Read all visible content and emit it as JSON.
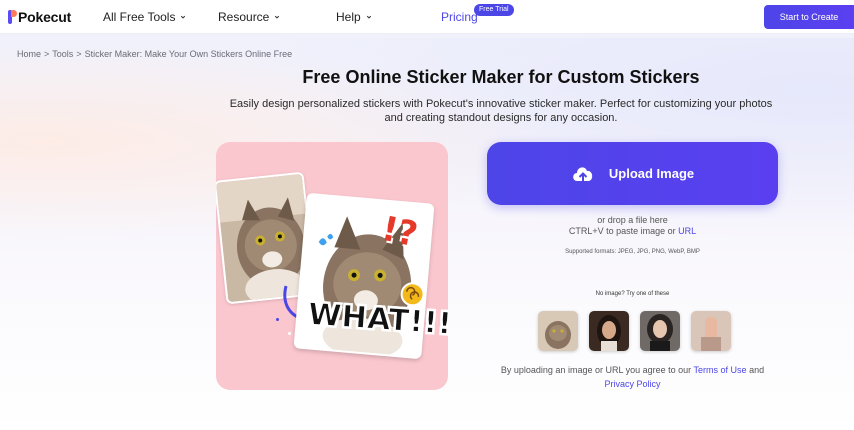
{
  "header": {
    "logo_text": "Pokecut",
    "nav": [
      {
        "label": "All Free Tools"
      },
      {
        "label": "Resource"
      },
      {
        "label": "Help"
      }
    ],
    "pricing_label": "Pricing",
    "pricing_badge": "Free Trial",
    "cta_label": "Start to Create"
  },
  "breadcrumb": {
    "items": [
      "Home",
      "Tools",
      "Sticker Maker: Make Your Own Stickers Online Free"
    ],
    "separator": ">"
  },
  "hero": {
    "title": "Free Online Sticker Maker for Custom Stickers",
    "subtitle": "Easily design personalized stickers with Pokecut's innovative sticker maker. Perfect for customizing your photos and creating standout designs for any occasion."
  },
  "illustration": {
    "sticker_text": "WHAT!!!",
    "exclaim": "!?"
  },
  "upload": {
    "button_label": "Upload Image",
    "drop_line": "or drop a file here",
    "paste_line": "CTRL+V to paste image or",
    "url_label": "URL",
    "formats": "Supported formats: JPEG, JPG, PNG, WebP, BMP",
    "try_text": "No image? Try one of these",
    "agree_prefix": "By uploading an image or URL you agree to our",
    "terms_label": "Terms of Use",
    "and_word": "and",
    "privacy_label": "Privacy Policy"
  },
  "colors": {
    "accent": "#4c46e6",
    "card_bg": "#fbc7cf"
  }
}
